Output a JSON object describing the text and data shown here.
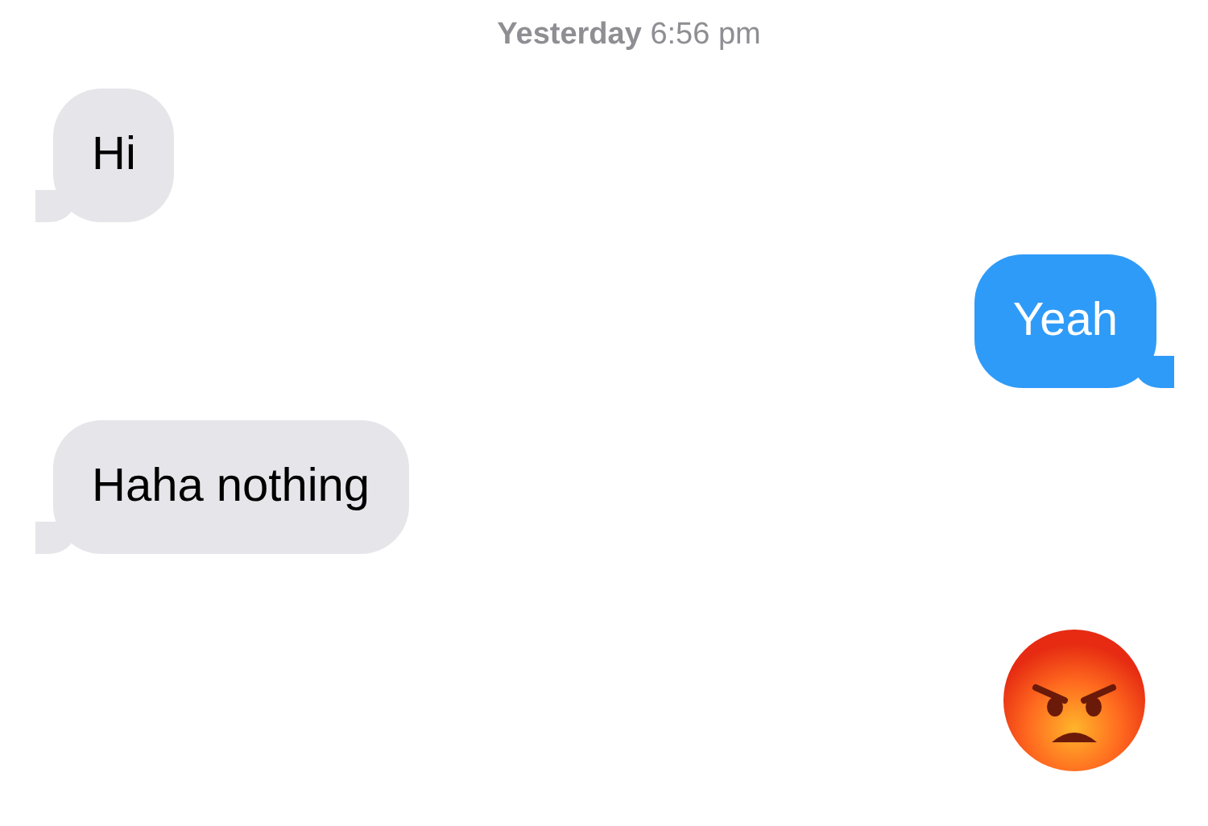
{
  "timestamp": {
    "day": "Yesterday",
    "time": "6:56 pm"
  },
  "messages": [
    {
      "kind": "text",
      "outgoing": false,
      "text": "Hi"
    },
    {
      "kind": "text",
      "outgoing": true,
      "text": "Yeah"
    },
    {
      "kind": "text",
      "outgoing": false,
      "text": "Haha nothing"
    },
    {
      "kind": "emoji",
      "outgoing": true
    }
  ]
}
